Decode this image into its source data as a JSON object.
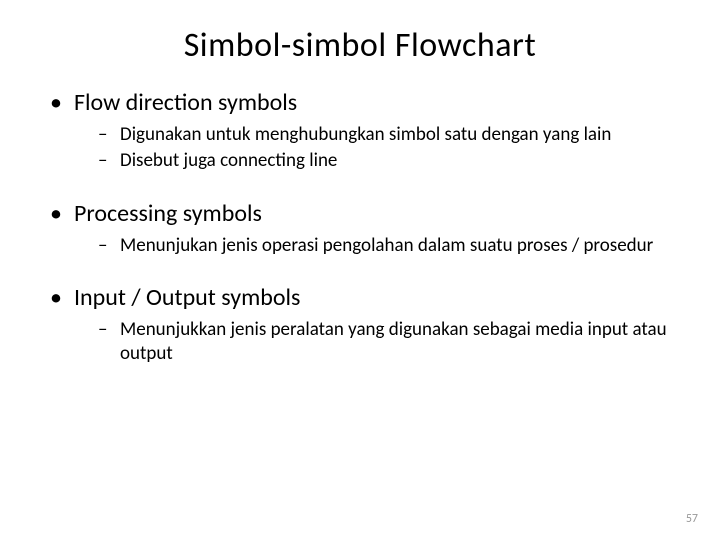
{
  "title": "Simbol-simbol Flowchart",
  "sections": [
    {
      "heading": "Flow direction symbols",
      "items": [
        "Digunakan untuk menghubungkan simbol satu dengan yang lain",
        "Disebut juga connecting line"
      ]
    },
    {
      "heading": "Processing symbols",
      "items": [
        "Menunjukan jenis operasi pengolahan dalam suatu proses / prosedur"
      ]
    },
    {
      "heading": "Input / Output symbols",
      "items": [
        "Menunjukkan jenis peralatan yang digunakan sebagai media input atau output"
      ]
    }
  ],
  "pageNumber": "57"
}
